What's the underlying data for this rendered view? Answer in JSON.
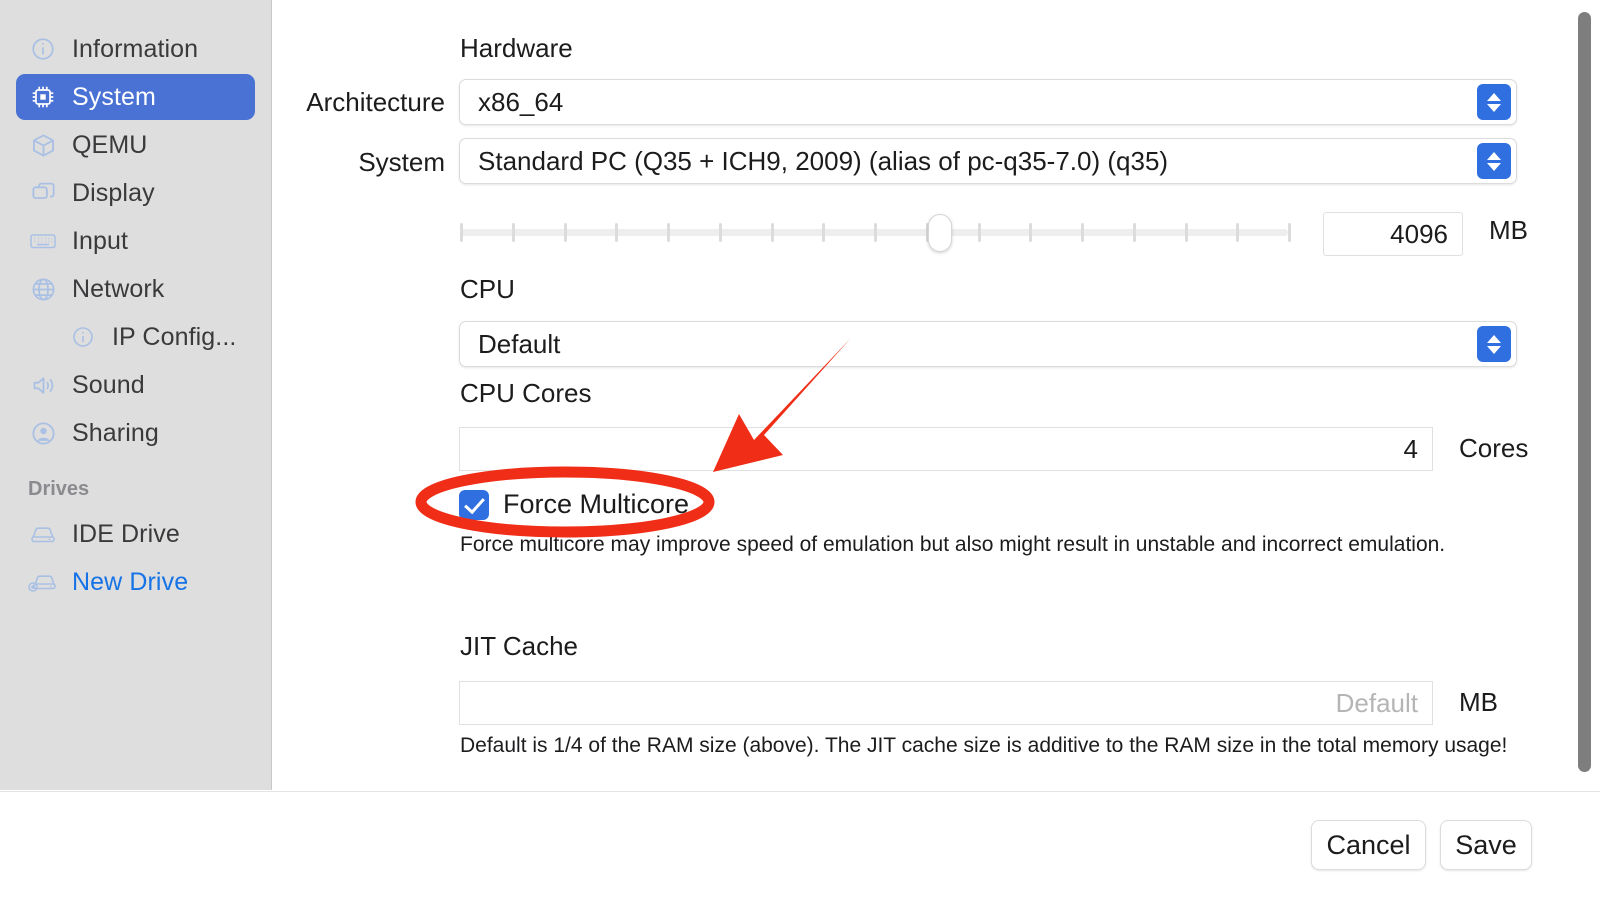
{
  "sidebar": {
    "items": [
      {
        "label": "Information",
        "icon": "info-circle-icon",
        "state": "normal",
        "indent": false
      },
      {
        "label": "System",
        "icon": "cpu-chip-icon",
        "state": "selected",
        "indent": false
      },
      {
        "label": "QEMU",
        "icon": "box-icon",
        "state": "normal",
        "indent": false
      },
      {
        "label": "Display",
        "icon": "windows-icon",
        "state": "normal",
        "indent": false
      },
      {
        "label": "Input",
        "icon": "keyboard-icon",
        "state": "normal",
        "indent": false
      },
      {
        "label": "Network",
        "icon": "globe-icon",
        "state": "normal",
        "indent": false
      },
      {
        "label": "IP Config...",
        "icon": "info-pin-icon",
        "state": "normal",
        "indent": true
      },
      {
        "label": "Sound",
        "icon": "speaker-icon",
        "state": "normal",
        "indent": false
      },
      {
        "label": "Sharing",
        "icon": "person-circle-icon",
        "state": "normal",
        "indent": false
      }
    ],
    "drives_header": "Drives",
    "drives": [
      {
        "label": "IDE Drive",
        "icon": "drive-icon",
        "state": "normal"
      },
      {
        "label": "New Drive",
        "icon": "drive-plus-icon",
        "state": "accent"
      }
    ]
  },
  "main": {
    "hardware_title": "Hardware",
    "architecture_label": "Architecture",
    "architecture_value": "x86_64",
    "system_label": "System",
    "system_value": "Standard PC (Q35 + ICH9, 2009) (alias of pc-q35-7.0) (q35)",
    "ram": {
      "value": "4096",
      "unit": "MB",
      "tick_count": 17,
      "knob_position_percent": 58
    },
    "cpu_title": "CPU",
    "cpu_value": "Default",
    "cpu_cores_title": "CPU Cores",
    "cpu_cores_value": "4",
    "cpu_cores_unit": "Cores",
    "force_multicore_label": "Force Multicore",
    "force_multicore_checked": true,
    "force_multicore_help": "Force multicore may improve speed of emulation but also might result in unstable and incorrect emulation.",
    "jit_title": "JIT Cache",
    "jit_placeholder": "Default",
    "jit_unit": "MB",
    "jit_help": "Default is 1/4 of the RAM size (above). The JIT cache size is additive to the RAM size in the total memory usage!"
  },
  "footer": {
    "cancel_label": "Cancel",
    "save_label": "Save"
  },
  "colors": {
    "accent_blue": "#2f6fe0",
    "selected_blue": "#4a72d4",
    "link_blue": "#1673e6",
    "sidebar_bg": "#dedede",
    "annotation_red": "#f02d16"
  }
}
